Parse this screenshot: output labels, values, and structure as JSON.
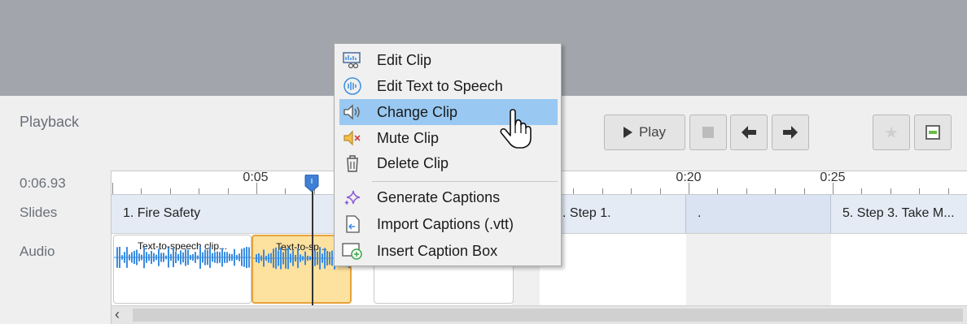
{
  "panel": {
    "playback_label": "Playback"
  },
  "controls": {
    "play_label": "Play"
  },
  "sidebar": {
    "time": "0:06.93",
    "slides_label": "Slides",
    "audio_label": "Audio"
  },
  "ruler": {
    "marks": [
      "0:05",
      "0:20",
      "0:25"
    ]
  },
  "slides": [
    "1. Fire Safety",
    ". Step 1.",
    ".",
    "5. Step 3. Take M..."
  ],
  "audio_clips": [
    {
      "title": "Text-to-speech clip..."
    },
    {
      "title": "Text-to-sp..."
    }
  ],
  "context_menu": {
    "items": [
      {
        "label": "Edit Clip",
        "icon": "edit-clip-icon"
      },
      {
        "label": "Edit Text to Speech",
        "icon": "text-to-speech-icon"
      },
      {
        "label": "Change Clip",
        "icon": "speaker-icon",
        "highlighted": true
      },
      {
        "label": "Mute Clip",
        "icon": "mute-icon"
      },
      {
        "label": "Delete Clip",
        "icon": "trash-icon"
      },
      {
        "label": "Generate Captions",
        "icon": "sparkle-icon"
      },
      {
        "label": "Import Captions (.vtt)",
        "icon": "import-icon"
      },
      {
        "label": "Insert Caption Box",
        "icon": "caption-box-icon"
      }
    ]
  },
  "colors": {
    "highlight": "#99c9f2",
    "selected_clip": "#fde19e",
    "waveform": "#3b8de0",
    "playhead": "#3f7fd6"
  }
}
